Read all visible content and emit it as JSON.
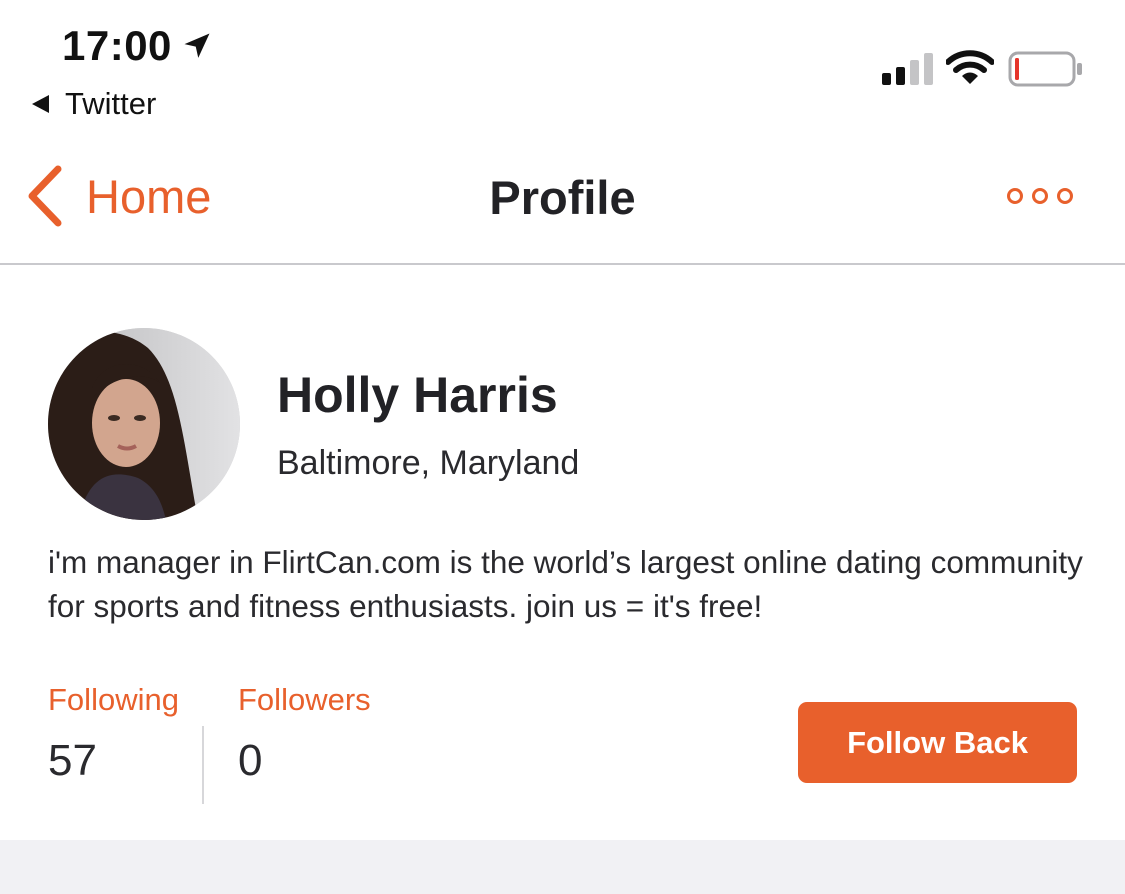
{
  "status_bar": {
    "time": "17:00",
    "back_app": "Twitter",
    "icons": [
      "location-arrow-icon",
      "signal-icon",
      "wifi-icon",
      "battery-icon"
    ]
  },
  "nav": {
    "back_label": "Home",
    "title": "Profile",
    "more_icon": "ellipsis-icon"
  },
  "profile": {
    "name": "Holly Harris",
    "location": "Baltimore, Maryland",
    "bio": "i'm manager in FlirtCan.com is the world’s largest online dating community for sports and fitness enthusiasts. join us = it's free!"
  },
  "stats": {
    "following_label": "Following",
    "following_value": "57",
    "followers_label": "Followers",
    "followers_value": "0"
  },
  "actions": {
    "follow_back_label": "Follow Back"
  },
  "colors": {
    "accent": "#e8602c",
    "text": "#222226",
    "divider": "#c9c9cd",
    "battery_low": "#e5352b"
  }
}
